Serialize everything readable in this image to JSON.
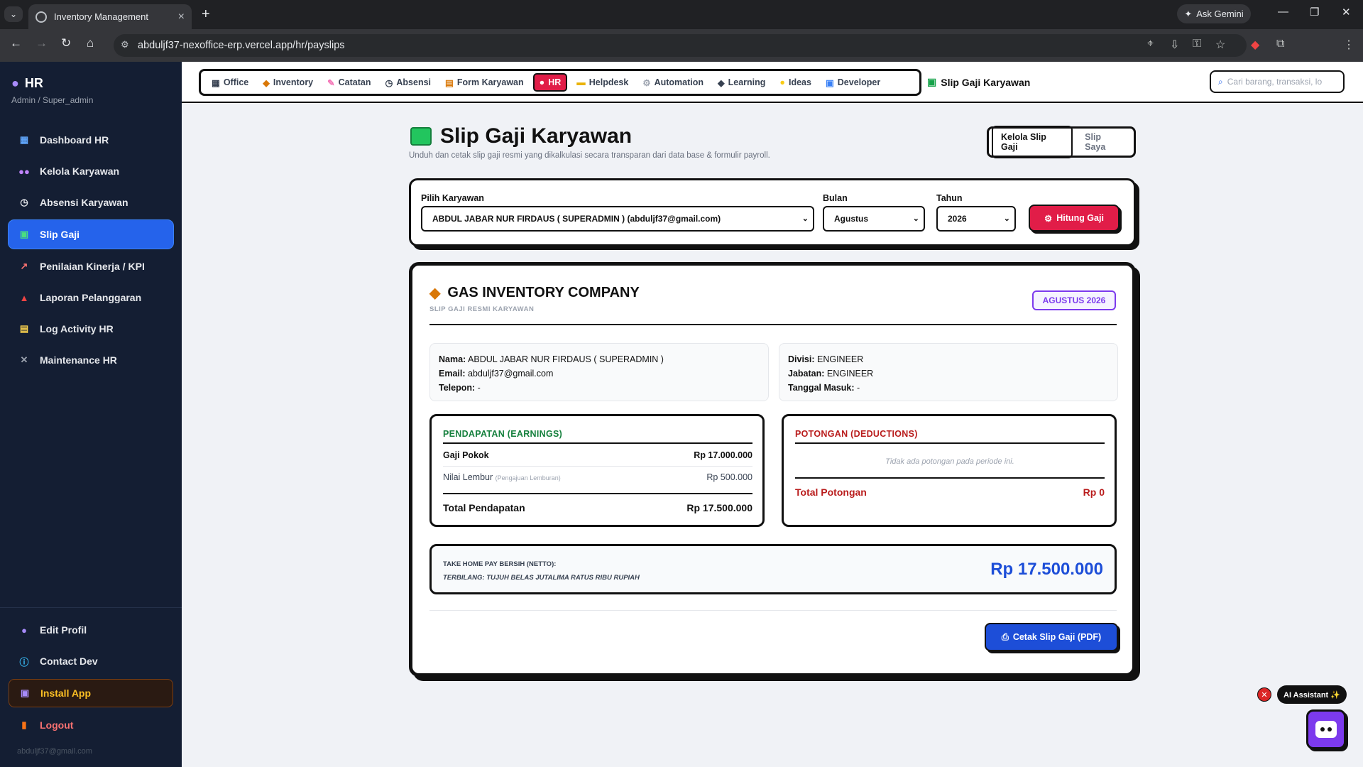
{
  "browser": {
    "tab_title": "Inventory Management",
    "url": "abduljf37-nexoffice-erp.vercel.app/hr/payslips",
    "gemini_label": "Ask Gemini"
  },
  "sidebar": {
    "title": "HR",
    "role": "Admin / Super_admin",
    "items": [
      {
        "label": "Dashboard HR",
        "icon": "chart-icon"
      },
      {
        "label": "Kelola Karyawan",
        "icon": "users-icon"
      },
      {
        "label": "Absensi Karyawan",
        "icon": "clock-icon"
      },
      {
        "label": "Slip Gaji",
        "icon": "money-icon",
        "active": true
      },
      {
        "label": "Penilaian Kinerja / KPI",
        "icon": "trend-icon"
      },
      {
        "label": "Laporan Pelanggaran",
        "icon": "siren-icon"
      },
      {
        "label": "Log Activity HR",
        "icon": "clipboard-icon"
      },
      {
        "label": "Maintenance HR",
        "icon": "tools-icon"
      }
    ],
    "bottom": [
      {
        "label": "Edit Profil",
        "icon": "user-icon"
      },
      {
        "label": "Contact Dev",
        "icon": "info-icon"
      },
      {
        "label": "Install App",
        "icon": "install-icon"
      },
      {
        "label": "Logout",
        "icon": "door-icon"
      }
    ],
    "email": "abduljf37@gmail.com"
  },
  "topnav": {
    "items": [
      "Office",
      "Inventory",
      "Catatan",
      "Absensi",
      "Form Karyawan",
      "HR",
      "Helpdesk",
      "Automation",
      "Learning",
      "Ideas",
      "Developer"
    ],
    "active": "HR",
    "crumb": "Slip Gaji Karyawan",
    "search_placeholder": "Cari barang, transaksi, lo"
  },
  "page": {
    "title": "Slip Gaji Karyawan",
    "subtitle": "Unduh dan cetak slip gaji resmi yang dikalkulasi secara transparan dari data base & formulir payroll.",
    "toggle": [
      "Kelola Slip Gaji",
      "Slip Saya"
    ]
  },
  "filter": {
    "employee_label": "Pilih Karyawan",
    "employee_value": "ABDUL JABAR NUR FIRDAUS ( SUPERADMIN ) (abduljf37@gmail.com)",
    "month_label": "Bulan",
    "month_value": "Agustus",
    "year_label": "Tahun",
    "year_value": "2026",
    "button": "Hitung Gaji"
  },
  "slip": {
    "company": "GAS INVENTORY COMPANY",
    "company_sub": "SLIP GAJI RESMI KARYAWAN",
    "period": "AGUSTUS 2026",
    "left_info": [
      {
        "k": "Nama:",
        "v": "ABDUL JABAR NUR FIRDAUS ( SUPERADMIN )"
      },
      {
        "k": "Email:",
        "v": "abduljf37@gmail.com"
      },
      {
        "k": "Telepon:",
        "v": "-"
      }
    ],
    "right_info": [
      {
        "k": "Divisi:",
        "v": "ENGINEER"
      },
      {
        "k": "Jabatan:",
        "v": "ENGINEER"
      },
      {
        "k": "Tanggal Masuk:",
        "v": "-"
      }
    ],
    "earnings": {
      "title": "PENDAPATAN (EARNINGS)",
      "rows": [
        {
          "label": "Gaji Pokok",
          "note": "",
          "value": "Rp 17.000.000"
        },
        {
          "label": "Nilai Lembur",
          "note": "(Pengajuan Lemburan)",
          "value": "Rp 500.000"
        }
      ],
      "total_label": "Total Pendapatan",
      "total_value": "Rp 17.500.000"
    },
    "deductions": {
      "title": "POTONGAN (DEDUCTIONS)",
      "empty": "Tidak ada potongan pada periode ini.",
      "total_label": "Total Potongan",
      "total_value": "Rp 0"
    },
    "thp_label": "TAKE HOME PAY BERSIH (NETTO):",
    "thp_words": "TERBILANG: TUJUH BELAS JUTALIMA RATUS RIBU RUPIAH",
    "thp_value": "Rp 17.500.000",
    "print_button": "Cetak Slip Gaji (PDF)"
  },
  "assistant": {
    "label": "AI Assistant ✨"
  },
  "colors": {
    "accent": "#e11d48",
    "primary": "#1d4ed8",
    "sidebar": "#141e33",
    "period": "#7c3aed"
  }
}
